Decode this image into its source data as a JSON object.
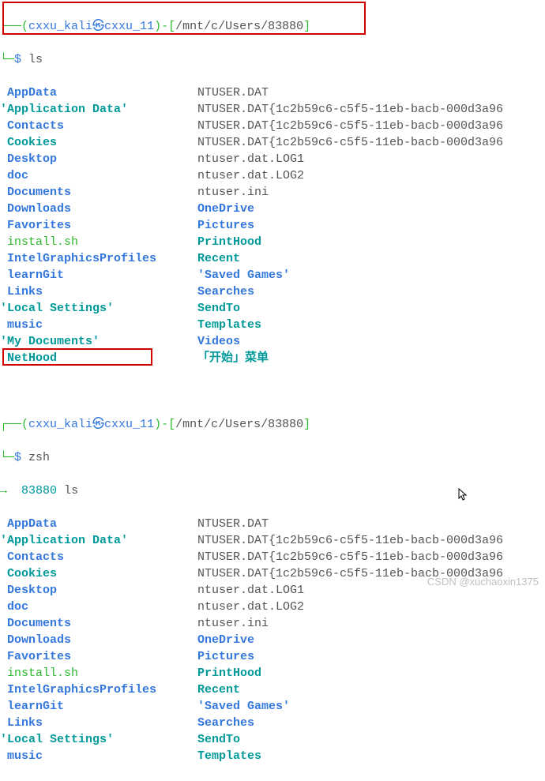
{
  "prompt1": {
    "corner_tl": "┌──(",
    "user": "cxxu_kali",
    "sep_icon": "㉿",
    "host": "cxxu_11",
    "close_paren": ")-[",
    "path": "/mnt/c/Users/83880",
    "close_bracket": "]",
    "corner_bl": "└─",
    "dollar": "$",
    "cmd": "ls"
  },
  "prompt2": {
    "corner_tl": "┌──(",
    "user": "cxxu_kali",
    "sep_icon": "㉿",
    "host": "cxxu_11",
    "close_paren": ")-[",
    "path": "/mnt/c/Users/83880",
    "close_bracket": "]",
    "corner_bl": "└─",
    "dollar": "$",
    "cmd": "zsh"
  },
  "prompt3": {
    "arrow": "→",
    "dir": "83880",
    "cmd": "ls"
  },
  "listing": [
    {
      "c1": " AppData",
      "c1_type": "dir",
      "c2": "NTUSER.DAT",
      "c2_type": "file"
    },
    {
      "c1": "'Application Data'",
      "c1_type": "link",
      "c2": "NTUSER.DAT{1c2b59c6-c5f5-11eb-bacb-000d3a96",
      "c2_type": "file"
    },
    {
      "c1": " Contacts",
      "c1_type": "dir",
      "c2": "NTUSER.DAT{1c2b59c6-c5f5-11eb-bacb-000d3a96",
      "c2_type": "file"
    },
    {
      "c1": " Cookies",
      "c1_type": "link",
      "c2": "NTUSER.DAT{1c2b59c6-c5f5-11eb-bacb-000d3a96",
      "c2_type": "file"
    },
    {
      "c1": " Desktop",
      "c1_type": "dir",
      "c2": "ntuser.dat.LOG1",
      "c2_type": "file"
    },
    {
      "c1": " doc",
      "c1_type": "dir",
      "c2": "ntuser.dat.LOG2",
      "c2_type": "file"
    },
    {
      "c1": " Documents",
      "c1_type": "dir",
      "c2": "ntuser.ini",
      "c2_type": "file"
    },
    {
      "c1": " Downloads",
      "c1_type": "dir",
      "c2": "OneDrive",
      "c2_type": "dir"
    },
    {
      "c1": " Favorites",
      "c1_type": "dir",
      "c2": "Pictures",
      "c2_type": "dir"
    },
    {
      "c1": " install.sh",
      "c1_type": "exec",
      "c2": "PrintHood",
      "c2_type": "link"
    },
    {
      "c1": " IntelGraphicsProfiles",
      "c1_type": "dir",
      "c2": "Recent",
      "c2_type": "link"
    },
    {
      "c1": " learnGit",
      "c1_type": "dir",
      "c2": "'Saved Games'",
      "c2_type": "dir"
    },
    {
      "c1": " Links",
      "c1_type": "dir",
      "c2": "Searches",
      "c2_type": "dir"
    },
    {
      "c1": "'Local Settings'",
      "c1_type": "link",
      "c2": "SendTo",
      "c2_type": "link"
    },
    {
      "c1": " music",
      "c1_type": "dir",
      "c2": "Templates",
      "c2_type": "link"
    },
    {
      "c1": "'My Documents'",
      "c1_type": "link",
      "c2": "Videos",
      "c2_type": "dir"
    },
    {
      "c1": " NetHood",
      "c1_type": "link",
      "c2": "「开始」菜单",
      "c2_type": "link"
    }
  ],
  "listing2_partial": [
    {
      "c1": " AppData",
      "c1_type": "dir",
      "c2": "NTUSER.DAT",
      "c2_type": "file"
    },
    {
      "c1": "'Application Data'",
      "c1_type": "link",
      "c2": "NTUSER.DAT{1c2b59c6-c5f5-11eb-bacb-000d3a96",
      "c2_type": "file"
    },
    {
      "c1": " Contacts",
      "c1_type": "dir",
      "c2": "NTUSER.DAT{1c2b59c6-c5f5-11eb-bacb-000d3a96",
      "c2_type": "file"
    },
    {
      "c1": " Cookies",
      "c1_type": "link",
      "c2": "NTUSER.DAT{1c2b59c6-c5f5-11eb-bacb-000d3a96",
      "c2_type": "file"
    },
    {
      "c1": " Desktop",
      "c1_type": "dir",
      "c2": "ntuser.dat.LOG1",
      "c2_type": "file"
    },
    {
      "c1": " doc",
      "c1_type": "dir",
      "c2": "ntuser.dat.LOG2",
      "c2_type": "file"
    },
    {
      "c1": " Documents",
      "c1_type": "dir",
      "c2": "ntuser.ini",
      "c2_type": "file"
    },
    {
      "c1": " Downloads",
      "c1_type": "dir",
      "c2": "OneDrive",
      "c2_type": "dir"
    },
    {
      "c1": " Favorites",
      "c1_type": "dir",
      "c2": "Pictures",
      "c2_type": "dir"
    },
    {
      "c1": " install.sh",
      "c1_type": "exec",
      "c2": "PrintHood",
      "c2_type": "link"
    },
    {
      "c1": " IntelGraphicsProfiles",
      "c1_type": "dir",
      "c2": "Recent",
      "c2_type": "link"
    },
    {
      "c1": " learnGit",
      "c1_type": "dir",
      "c2": "'Saved Games'",
      "c2_type": "dir"
    },
    {
      "c1": " Links",
      "c1_type": "dir",
      "c2": "Searches",
      "c2_type": "dir"
    },
    {
      "c1": "'Local Settings'",
      "c1_type": "link",
      "c2": "SendTo",
      "c2_type": "link"
    },
    {
      "c1": " music",
      "c1_type": "dir",
      "c2": "Templates",
      "c2_type": "link"
    }
  ],
  "colors": {
    "dir": "#3377dd",
    "link": "#009999",
    "exec": "#2eb82e",
    "file": "#555555"
  },
  "watermark": "CSDN @xuchaoxin1375"
}
